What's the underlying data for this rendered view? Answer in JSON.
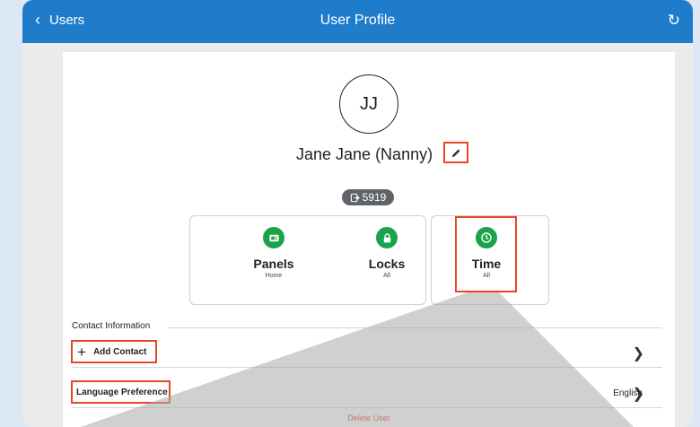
{
  "navbar": {
    "back_label": "Users",
    "title": "User Profile"
  },
  "profile": {
    "initials": "JJ",
    "name": "Jane Jane (Nanny)",
    "badge_value": "5919"
  },
  "tiles": [
    {
      "label": "Panels",
      "sub": "Home",
      "icon": "panel-icon"
    },
    {
      "label": "Locks",
      "sub": "All",
      "icon": "lock-icon"
    },
    {
      "label": "Time",
      "sub": "All",
      "icon": "clock-icon"
    }
  ],
  "contact": {
    "section_title": "Contact Information",
    "add_contact_label": "Add Contact"
  },
  "language": {
    "label": "Language Preference",
    "value": "English"
  },
  "delete_label": "Delete User",
  "colors": {
    "accent_blue": "#1f7ccb",
    "tile_green": "#1aa34a",
    "highlight_red": "#e8462a",
    "delete_red": "#e33c2f"
  }
}
